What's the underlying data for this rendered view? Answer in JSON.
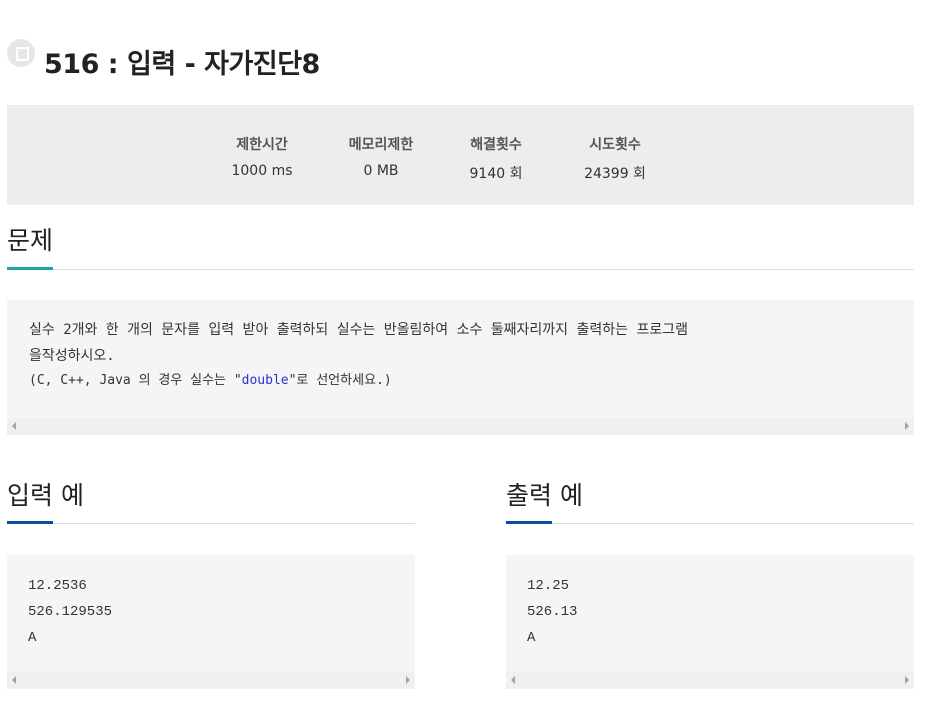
{
  "problem": {
    "number": "516",
    "separator": ":",
    "name": "입력 - 자가진단8"
  },
  "stats": [
    {
      "label": "제한시간",
      "value": "1000 ms"
    },
    {
      "label": "메모리제한",
      "value": "0 MB"
    },
    {
      "label": "해결횟수",
      "value": "9140 회"
    },
    {
      "label": "시도횟수",
      "value": "24399 회"
    }
  ],
  "sections": {
    "problem_heading": "문제",
    "input_heading": "입력 예",
    "output_heading": "출력 예"
  },
  "problem_body": {
    "line1": "실수 2개와 한 개의 문자를 입력 받아 출력하되 실수는 반올림하여 소수 둘째자리까지 출력하는 프로그램",
    "line2": "을작성하시오.",
    "note_prefix": "(C, C++, Java 의 경우 실수는 \"",
    "note_keyword": "double",
    "note_suffix": "\"로 선언하세요.)"
  },
  "sample_input": [
    "12.2536",
    "526.129535",
    "A"
  ],
  "sample_output": [
    "12.25",
    "526.13",
    "A"
  ],
  "colors": {
    "problem_accent": "#1fa3a8",
    "sample_accent": "#0b4da2",
    "keyword": "#2b32c8",
    "stats_bg": "#ededed",
    "code_bg": "#f5f5f7"
  }
}
